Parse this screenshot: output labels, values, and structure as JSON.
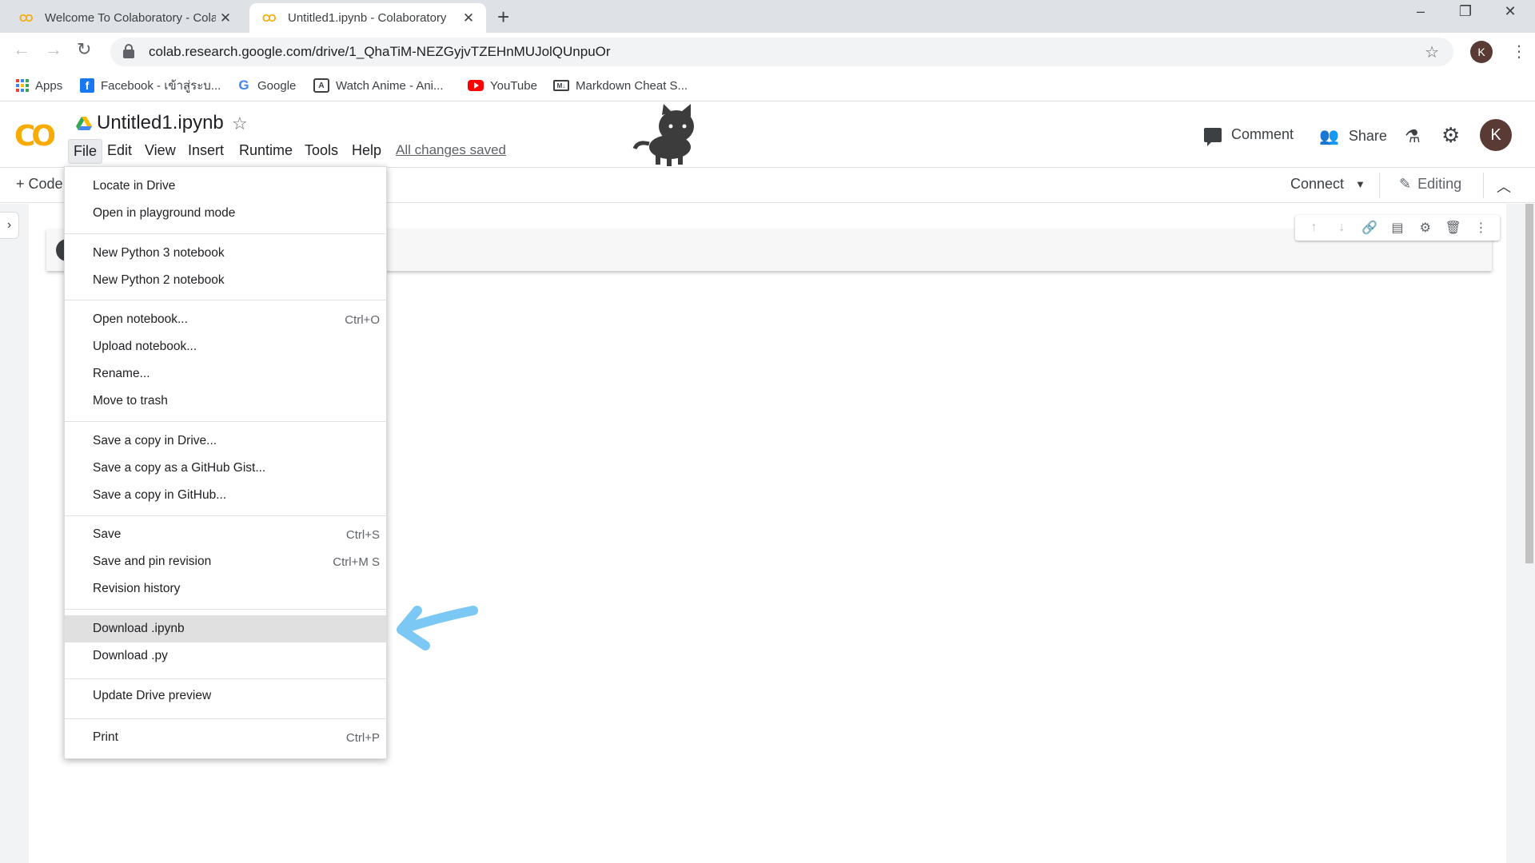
{
  "browser": {
    "tabs": [
      {
        "title": "Welcome To Colaboratory - Colab",
        "active": false
      },
      {
        "title": "Untitled1.ipynb - Colaboratory",
        "active": true
      }
    ],
    "new_tab": "+",
    "window_controls": {
      "minimize": "–",
      "restore": "❐",
      "close": "✕"
    },
    "url": "colab.research.google.com/drive/1_QhaTiM-NEZGyjvTZEHnMUJolQUnpuOr",
    "profile_initial": "K",
    "bookmarks": [
      {
        "label": "Apps",
        "icon": "apps-grid-icon"
      },
      {
        "label": "Facebook - เข้าสู่ระบ...",
        "icon": "facebook-icon"
      },
      {
        "label": "Google",
        "icon": "google-icon"
      },
      {
        "label": "Watch Anime - Ani...",
        "icon": "anime-icon"
      },
      {
        "label": "YouTube",
        "icon": "youtube-icon"
      },
      {
        "label": "Markdown Cheat S...",
        "icon": "markdown-icon"
      }
    ]
  },
  "colab": {
    "logo": "CO",
    "notebook_title": "Untitled1.ipynb",
    "menus": [
      "File",
      "Edit",
      "View",
      "Insert",
      "Runtime",
      "Tools",
      "Help"
    ],
    "save_status": "All changes saved",
    "header_actions": {
      "comment": "Comment",
      "share": "Share",
      "avatar_initial": "K"
    },
    "toolbar": {
      "add_code": "+ Code",
      "connect": "Connect",
      "editing": "Editing"
    }
  },
  "file_menu": {
    "groups": [
      [
        {
          "label": "Locate in Drive",
          "shortcut": ""
        },
        {
          "label": "Open in playground mode",
          "shortcut": ""
        }
      ],
      [
        {
          "label": "New Python 3 notebook",
          "shortcut": ""
        },
        {
          "label": "New Python 2 notebook",
          "shortcut": ""
        }
      ],
      [
        {
          "label": "Open notebook...",
          "shortcut": "Ctrl+O"
        },
        {
          "label": "Upload notebook...",
          "shortcut": ""
        },
        {
          "label": "Rename...",
          "shortcut": ""
        },
        {
          "label": "Move to trash",
          "shortcut": ""
        }
      ],
      [
        {
          "label": "Save a copy in Drive...",
          "shortcut": ""
        },
        {
          "label": "Save a copy as a GitHub Gist...",
          "shortcut": ""
        },
        {
          "label": "Save a copy in GitHub...",
          "shortcut": ""
        }
      ],
      [
        {
          "label": "Save",
          "shortcut": "Ctrl+S"
        },
        {
          "label": "Save and pin revision",
          "shortcut": "Ctrl+M S"
        },
        {
          "label": "Revision history",
          "shortcut": ""
        }
      ],
      [
        {
          "label": "Download .ipynb",
          "shortcut": "",
          "highlighted": true
        },
        {
          "label": "Download .py",
          "shortcut": ""
        }
      ],
      [
        {
          "label": "Update Drive preview",
          "shortcut": ""
        }
      ],
      [
        {
          "label": "Print",
          "shortcut": "Ctrl+P"
        }
      ]
    ]
  },
  "colors": {
    "accent_orange": "#f9ab00",
    "annotation_arrow": "#7cc8f5",
    "highlight_bg": "#e0e0e0"
  }
}
